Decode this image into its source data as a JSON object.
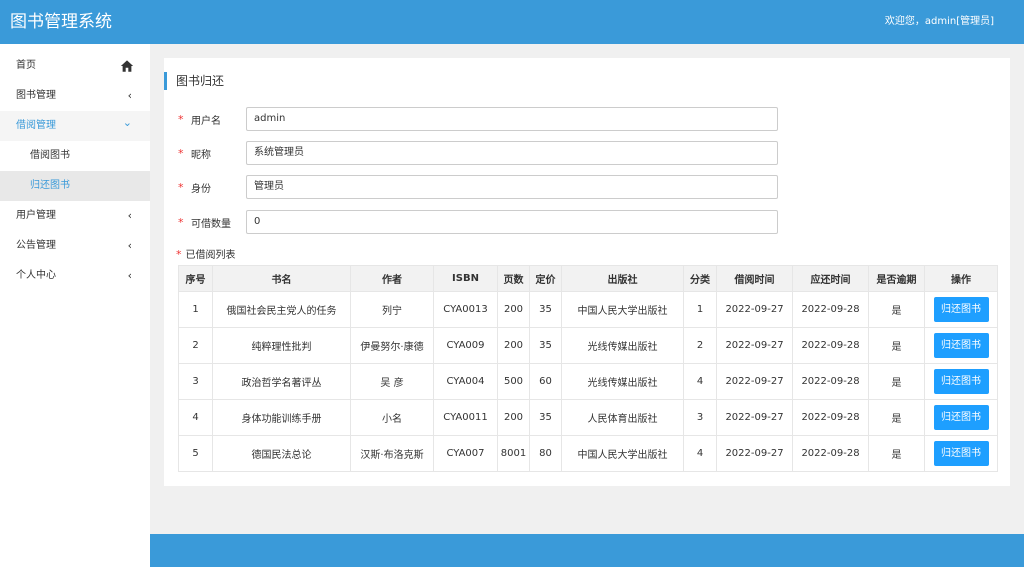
{
  "header": {
    "title": "图书管理系统",
    "welcome": "欢迎您，admin[管理员]"
  },
  "sidebar": {
    "home": "首页",
    "book_mgmt": "图书管理",
    "borrow_mgmt": "借阅管理",
    "borrow_book": "借阅图书",
    "return_book": "归还图书",
    "user_mgmt": "用户管理",
    "notice_mgmt": "公告管理",
    "personal": "个人中心",
    "arrow_collapsed": "‹",
    "arrow_open": "⌄"
  },
  "page": {
    "title": "图书归还",
    "required_mark": "*",
    "form": {
      "username_label": "用户名",
      "username_value": "admin",
      "nickname_label": "昵称",
      "nickname_value": "系统管理员",
      "identity_label": "身份",
      "identity_value": "管理员",
      "quota_label": "可借数量",
      "quota_value": "0"
    },
    "list_label": "已借阅列表"
  },
  "table": {
    "headers": [
      "序号",
      "书名",
      "作者",
      "ISBN",
      "页数",
      "定价",
      "出版社",
      "分类",
      "借阅时间",
      "应还时间",
      "是否逾期",
      "操作"
    ],
    "rows": [
      [
        "1",
        "俄国社会民主党人的任务",
        "列宁",
        "CYA0013",
        "200",
        "35",
        "中国人民大学出版社",
        "1",
        "2022-09-27",
        "2022-09-28",
        "是"
      ],
      [
        "2",
        "纯粹理性批判",
        "伊曼努尔·康德",
        "CYA009",
        "200",
        "35",
        "光线传媒出版社",
        "2",
        "2022-09-27",
        "2022-09-28",
        "是"
      ],
      [
        "3",
        "政治哲学名著评丛",
        "吴 彦",
        "CYA004",
        "500",
        "60",
        "光线传媒出版社",
        "4",
        "2022-09-27",
        "2022-09-28",
        "是"
      ],
      [
        "4",
        "身体功能训练手册",
        "小名",
        "CYA0011",
        "200",
        "35",
        "人民体育出版社",
        "3",
        "2022-09-27",
        "2022-09-28",
        "是"
      ],
      [
        "5",
        "德国民法总论",
        "汉斯·布洛克斯",
        "CYA007",
        "8001",
        "80",
        "中国人民大学出版社",
        "4",
        "2022-09-27",
        "2022-09-28",
        "是"
      ]
    ],
    "action_label": "归还图书"
  }
}
